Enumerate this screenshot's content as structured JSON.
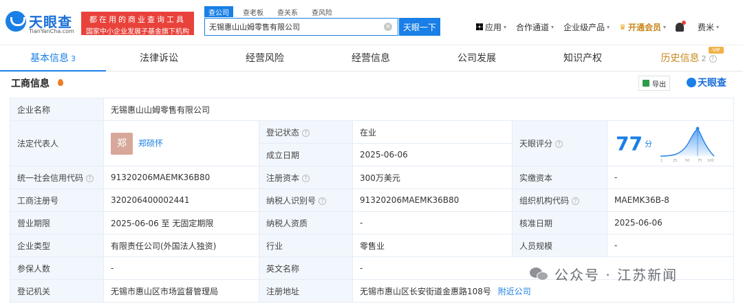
{
  "header": {
    "logo_text": "天眼查",
    "logo_domain": "TianYanCha.com",
    "slogan_line1": "都在用的商业查询工具",
    "slogan_line2": "国家中小企业发展子基金旗下机构",
    "search_tabs": [
      "查公司",
      "查老板",
      "查关系",
      "查风险"
    ],
    "search_value": "无锡惠山山姆零售有限公司",
    "search_button": "天眼一下",
    "nav": {
      "app": "应用",
      "cooperation": "合作通道",
      "enterprise": "企业级产品",
      "vip": "开通会员",
      "user": "费米"
    }
  },
  "tabs": [
    {
      "label": "基本信息",
      "count": "3"
    },
    {
      "label": "法律诉讼"
    },
    {
      "label": "经营风险"
    },
    {
      "label": "经营信息"
    },
    {
      "label": "公司发展"
    },
    {
      "label": "知识产权"
    },
    {
      "label": "历史信息",
      "count": "2",
      "tag": "VIP"
    }
  ],
  "section": {
    "title": "工商信息",
    "export": "导出",
    "brand": "天眼查"
  },
  "info": {
    "company_name_k": "企业名称",
    "company_name_v": "无锡惠山山姆零售有限公司",
    "legal_rep_k": "法定代表人",
    "legal_rep_avatar": "郑",
    "legal_rep_v": "郑硕怀",
    "reg_status_k": "登记状态",
    "reg_status_v": "在业",
    "found_date_k": "成立日期",
    "found_date_v": "2025-06-06",
    "tianyan_score_k": "天眼评分",
    "tianyan_score_v": "77",
    "tianyan_score_unit": "分",
    "credit_code_k": "统一社会信用代码",
    "credit_code_v": "91320206MAEMK36B80",
    "reg_capital_k": "注册资本",
    "reg_capital_v": "300万美元",
    "paid_capital_k": "实缴资本",
    "paid_capital_v": "-",
    "reg_no_k": "工商注册号",
    "reg_no_v": "320206400002441",
    "taxpayer_id_k": "纳税人识别号",
    "taxpayer_id_v": "91320206MAEMK36B80",
    "org_code_k": "组织机构代码",
    "org_code_v": "MAEMK36B-8",
    "biz_term_k": "营业期限",
    "biz_term_v": "2025-06-06 至 无固定期限",
    "taxpayer_qual_k": "纳税人资质",
    "taxpayer_qual_v": "-",
    "approve_date_k": "核准日期",
    "approve_date_v": "2025-06-06",
    "company_type_k": "企业类型",
    "company_type_v": "有限责任公司(外国法人独资)",
    "industry_k": "行业",
    "industry_v": "零售业",
    "staff_size_k": "人员规模",
    "staff_size_v": "-",
    "insured_k": "参保人数",
    "insured_v": "-",
    "english_name_k": "英文名称",
    "english_name_v": "-",
    "reg_authority_k": "登记机关",
    "reg_authority_v": "无锡市惠山区市场监督管理局",
    "reg_address_k": "注册地址",
    "reg_address_v": "无锡市惠山区长安街道金惠路108号",
    "nearby": "附近公司"
  },
  "score_chart": {
    "ticks": [
      "1",
      "25",
      "50",
      "75",
      "100"
    ]
  },
  "watermark": {
    "text": "公众号 · 江苏新闻"
  },
  "colors": {
    "brand_blue": "#1a7fe6",
    "slogan_red": "#e8423b",
    "status_green": "#19a05c",
    "vip_gold": "#c7881c"
  }
}
